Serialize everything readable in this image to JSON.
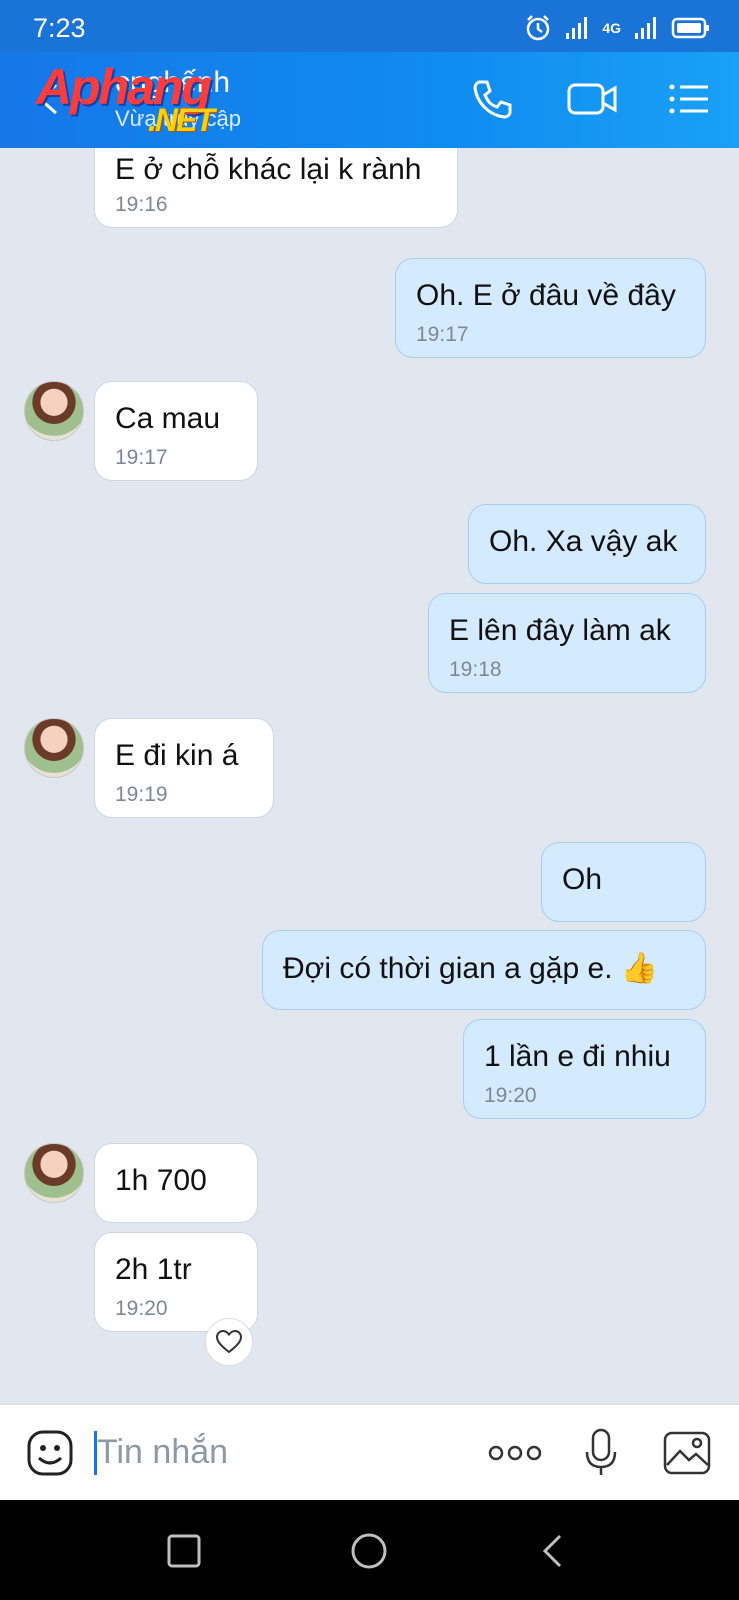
{
  "status": {
    "time": "7:23",
    "network": "4G"
  },
  "header": {
    "title": "cnghếnh",
    "subtitle": "Vừa truy cập",
    "watermark": "Aphang",
    "watermark_suffix": ".NET"
  },
  "messages": [
    {
      "dir": "in",
      "text": "E ở chỗ khác lại k rành",
      "time": "19:16"
    },
    {
      "dir": "out",
      "text": "Oh. E ở đâu về đây",
      "time": "19:17"
    },
    {
      "dir": "in",
      "text": "Ca mau",
      "time": "19:17"
    },
    {
      "dir": "out",
      "text": "Oh. Xa vậy ak",
      "time": ""
    },
    {
      "dir": "out",
      "text": "E lên đây làm ak",
      "time": "19:18"
    },
    {
      "dir": "in",
      "text": "E đi kin á",
      "time": "19:19"
    },
    {
      "dir": "out",
      "text": "Oh",
      "time": ""
    },
    {
      "dir": "out",
      "text": "Đợi có thời gian a gặp e. 👍",
      "time": ""
    },
    {
      "dir": "out",
      "text": "1 lần e đi nhiu",
      "time": "19:20"
    },
    {
      "dir": "in",
      "text": "1h 700",
      "time": ""
    },
    {
      "dir": "in",
      "text": "2h 1tr",
      "time": "19:20"
    }
  ],
  "composer": {
    "placeholder": "Tin nhắn"
  },
  "colors": {
    "header": "#1677e8",
    "out_bubble": "#d4eafe",
    "in_bubble": "#ffffff",
    "background": "#e2e7ef"
  }
}
